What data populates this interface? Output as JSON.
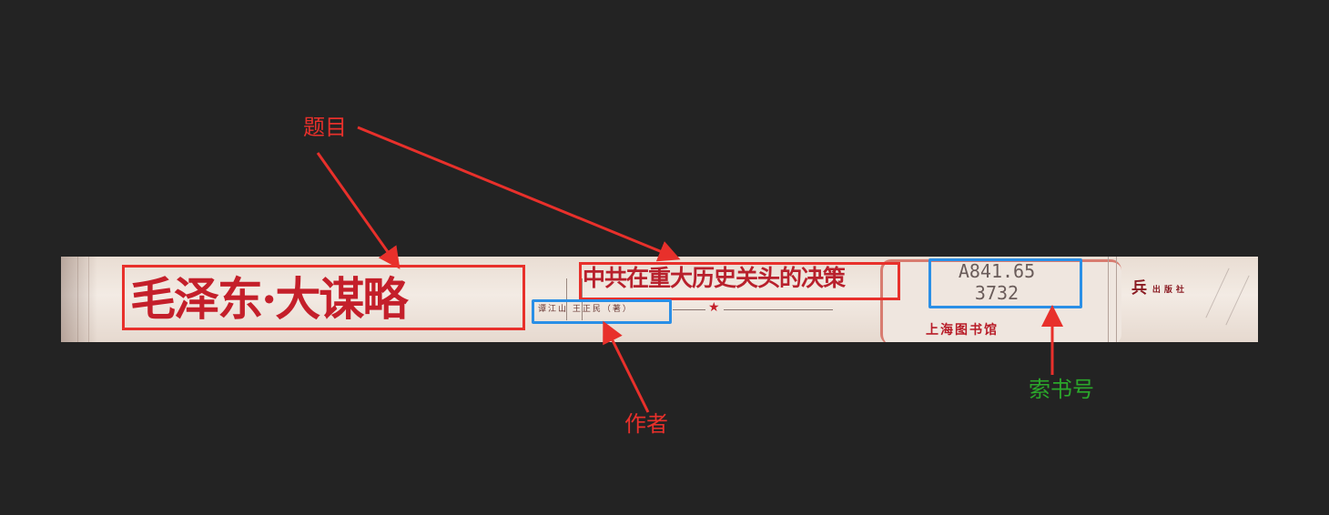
{
  "spine": {
    "title": "毛泽东·大谋略",
    "subtitle": "中共在重大历史关头的决策",
    "author": "谭江山 王正民（著）",
    "call_number": "A841.65\n3732",
    "library": "上海图书馆",
    "publisher_mark": "兵",
    "publisher_text": "出版社"
  },
  "annotations": {
    "title_label": "题目",
    "author_label": "作者",
    "call_number_label": "索书号"
  },
  "colors": {
    "title_box": "#e8302b",
    "author_box": "#2a8fe6",
    "call_number_box": "#2a8fe6",
    "title_label": "#e8302b",
    "author_label": "#e8302b",
    "call_number_label": "#2ba82b",
    "arrow": "#e8302b"
  }
}
